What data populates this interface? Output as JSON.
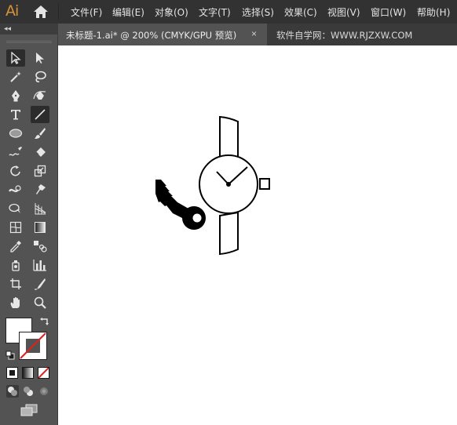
{
  "app": {
    "logo_text": "Ai"
  },
  "menu": [
    {
      "label": "文件(F)"
    },
    {
      "label": "编辑(E)"
    },
    {
      "label": "对象(O)"
    },
    {
      "label": "文字(T)"
    },
    {
      "label": "选择(S)"
    },
    {
      "label": "效果(C)"
    },
    {
      "label": "视图(V)"
    },
    {
      "label": "窗口(W)"
    },
    {
      "label": "帮助(H)"
    }
  ],
  "tabs": {
    "active_label": "未标题-1.ai* @ 200% (CMYK/GPU 预览)",
    "close_symbol": "×",
    "watermark": "软件自学网：WWW.RJZXW.COM"
  },
  "toolbar": {
    "collapse_symbol": "◂◂",
    "selected_tool": "line-segment-tool",
    "fill_color": "#ffffff",
    "stroke_color": "none",
    "tools": [
      "selection-tool",
      "direct-selection-tool",
      "magic-wand-tool",
      "lasso-tool",
      "pen-tool",
      "curvature-tool",
      "type-tool",
      "line-segment-tool",
      "ellipse-tool",
      "paintbrush-tool",
      "shaper-tool",
      "eraser-tool",
      "rotate-tool",
      "scale-tool",
      "width-tool",
      "puppet-warp-tool",
      "shape-builder-tool",
      "perspective-grid-tool",
      "mesh-tool",
      "gradient-tool",
      "eyedropper-tool",
      "blend-tool",
      "symbol-sprayer-tool",
      "column-graph-tool",
      "artboard-tool",
      "slice-tool",
      "hand-tool",
      "zoom-tool"
    ]
  },
  "colors": {
    "canvas": "#ffffff",
    "ui_dark": "#323232",
    "ui_panel": "#535353",
    "accent_logo": "#d9923a",
    "artwork_stroke": "#000000"
  }
}
